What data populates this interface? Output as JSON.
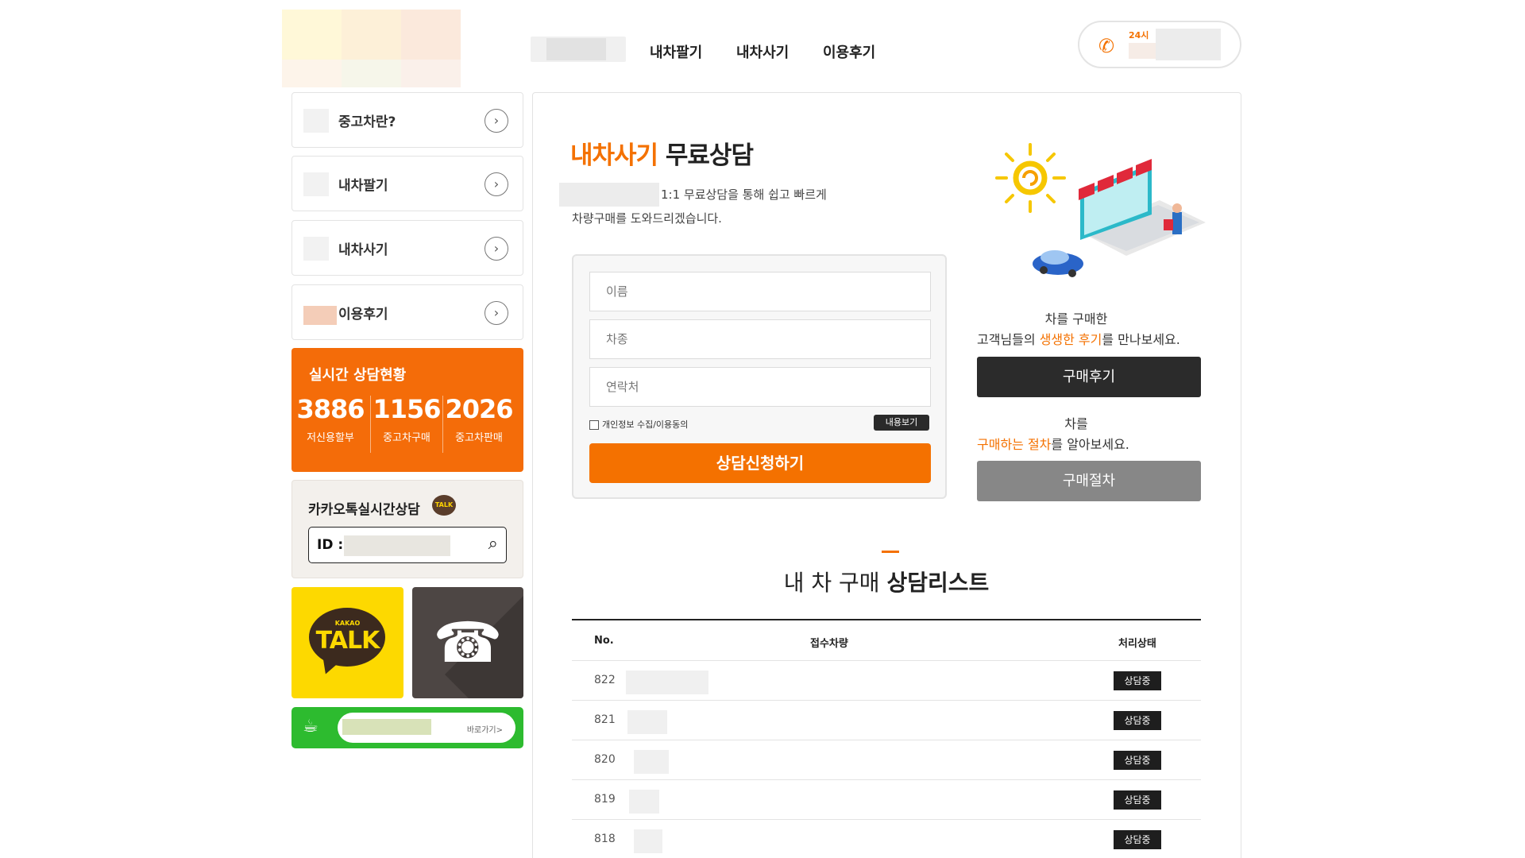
{
  "header": {
    "nav": [
      "내차팔기",
      "내차사기",
      "이용후기"
    ],
    "phone_label": "24시"
  },
  "sidebar": {
    "items": [
      {
        "label": "중고차란?"
      },
      {
        "label": "내차팔기"
      },
      {
        "label": "내차사기"
      },
      {
        "label": "이용후기"
      }
    ],
    "status": {
      "title": "실시간 상담현황",
      "stats": [
        {
          "value": "3886",
          "label": "저신용할부"
        },
        {
          "value": "1156",
          "label": "중고차구매"
        },
        {
          "value": "2026",
          "label": "중고차판매"
        }
      ]
    },
    "kakao": {
      "title": "카카오톡실시간상담",
      "talk_badge": "TALK",
      "id_label": "ID :"
    },
    "talk_button": {
      "small": "KAKAO",
      "big": "TALK"
    },
    "cafe": {
      "go_label": "바로가기>"
    }
  },
  "main": {
    "title_orange": "내차사기",
    "title_black": "무료상담",
    "subtitle_line1": "1:1 무료상담을 통해 쉽고 빠르게",
    "subtitle_line2": "차량구매를 도와드리겠습니다.",
    "form": {
      "name_placeholder": "이름",
      "car_placeholder": "차종",
      "contact_placeholder": "연락처",
      "agree_label": "개인정보 수집/이용동의",
      "view_label": "내용보기",
      "submit_label": "상담신청하기"
    },
    "right": {
      "review_line1": "차를 구매한",
      "review_line2_a": "고객님들의 ",
      "review_line2_b": "생생한 후기",
      "review_line2_c": "를 만나보세요.",
      "review_button": "구매후기",
      "process_line1": "차를",
      "process_line2_a": "구매하는 절차",
      "process_line2_b": "를 알아보세요.",
      "process_button": "구매절차"
    },
    "list": {
      "title_a": "내 차 구매 ",
      "title_b": "상담리스트",
      "headers": {
        "no": "No.",
        "car": "접수차량",
        "status": "처리상태"
      },
      "rows": [
        {
          "no": "822",
          "status": "상담중"
        },
        {
          "no": "821",
          "status": "상담중"
        },
        {
          "no": "820",
          "status": "상담중"
        },
        {
          "no": "819",
          "status": "상담중"
        },
        {
          "no": "818",
          "status": "상담중"
        }
      ]
    }
  },
  "colors": {
    "accent": "#f47100",
    "kakao": "#fdd900",
    "cafe": "#2dbb2f"
  }
}
